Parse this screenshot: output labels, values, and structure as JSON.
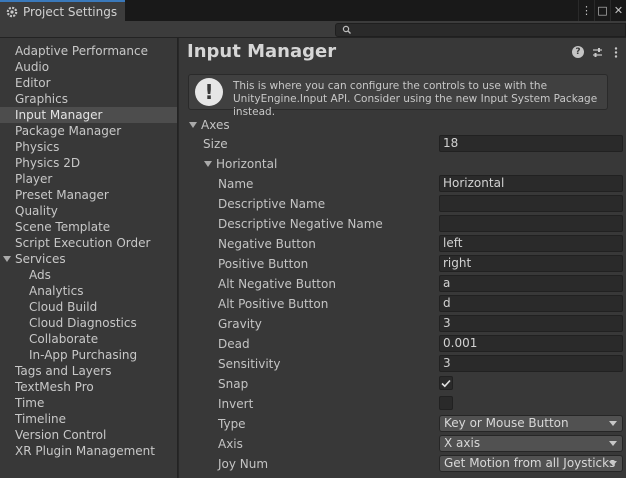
{
  "window": {
    "tab_title": "Project Settings",
    "title_icons": [
      "⋮",
      "□",
      "✕"
    ]
  },
  "search": {
    "value": "",
    "placeholder": ""
  },
  "sidebar": {
    "items": [
      {
        "label": "Adaptive Performance",
        "level": 0
      },
      {
        "label": "Audio",
        "level": 0
      },
      {
        "label": "Editor",
        "level": 0
      },
      {
        "label": "Graphics",
        "level": 0
      },
      {
        "label": "Input Manager",
        "level": 0,
        "selected": true
      },
      {
        "label": "Package Manager",
        "level": 0
      },
      {
        "label": "Physics",
        "level": 0
      },
      {
        "label": "Physics 2D",
        "level": 0
      },
      {
        "label": "Player",
        "level": 0
      },
      {
        "label": "Preset Manager",
        "level": 0
      },
      {
        "label": "Quality",
        "level": 0
      },
      {
        "label": "Scene Template",
        "level": 0
      },
      {
        "label": "Script Execution Order",
        "level": 0
      },
      {
        "label": "Services",
        "level": 0,
        "expanded": true
      },
      {
        "label": "Ads",
        "level": 1
      },
      {
        "label": "Analytics",
        "level": 1
      },
      {
        "label": "Cloud Build",
        "level": 1
      },
      {
        "label": "Cloud Diagnostics",
        "level": 1
      },
      {
        "label": "Collaborate",
        "level": 1
      },
      {
        "label": "In-App Purchasing",
        "level": 1
      },
      {
        "label": "Tags and Layers",
        "level": 0
      },
      {
        "label": "TextMesh Pro",
        "level": 0
      },
      {
        "label": "Time",
        "level": 0
      },
      {
        "label": "Timeline",
        "level": 0
      },
      {
        "label": "Version Control",
        "level": 0
      },
      {
        "label": "XR Plugin Management",
        "level": 0
      }
    ]
  },
  "main": {
    "title": "Input Manager",
    "info_message": "This is where you can configure the controls to use with the UnityEngine.Input API. Consider using the new Input System Package instead.",
    "axes_label": "Axes",
    "size_label": "Size",
    "size_value": "18",
    "group_label": "Horizontal",
    "fields": [
      {
        "label": "Name",
        "kind": "text",
        "value": "Horizontal"
      },
      {
        "label": "Descriptive Name",
        "kind": "text",
        "value": ""
      },
      {
        "label": "Descriptive Negative Name",
        "kind": "text",
        "value": ""
      },
      {
        "label": "Negative Button",
        "kind": "text",
        "value": "left"
      },
      {
        "label": "Positive Button",
        "kind": "text",
        "value": "right"
      },
      {
        "label": "Alt Negative Button",
        "kind": "text",
        "value": "a"
      },
      {
        "label": "Alt Positive Button",
        "kind": "text",
        "value": "d"
      },
      {
        "label": "Gravity",
        "kind": "text",
        "value": "3"
      },
      {
        "label": "Dead",
        "kind": "text",
        "value": "0.001"
      },
      {
        "label": "Sensitivity",
        "kind": "text",
        "value": "3"
      },
      {
        "label": "Snap",
        "kind": "checkbox",
        "checked": true
      },
      {
        "label": "Invert",
        "kind": "checkbox",
        "checked": false
      },
      {
        "label": "Type",
        "kind": "dropdown",
        "value": "Key or Mouse Button"
      },
      {
        "label": "Axis",
        "kind": "dropdown",
        "value": "X axis"
      },
      {
        "label": "Joy Num",
        "kind": "dropdown",
        "value": "Get Motion from all Joysticks"
      }
    ]
  },
  "colors": {
    "accent": "#3a79bb",
    "panel": "#383838",
    "field": "#2a2a2a",
    "selected": "#4d4d4d"
  }
}
